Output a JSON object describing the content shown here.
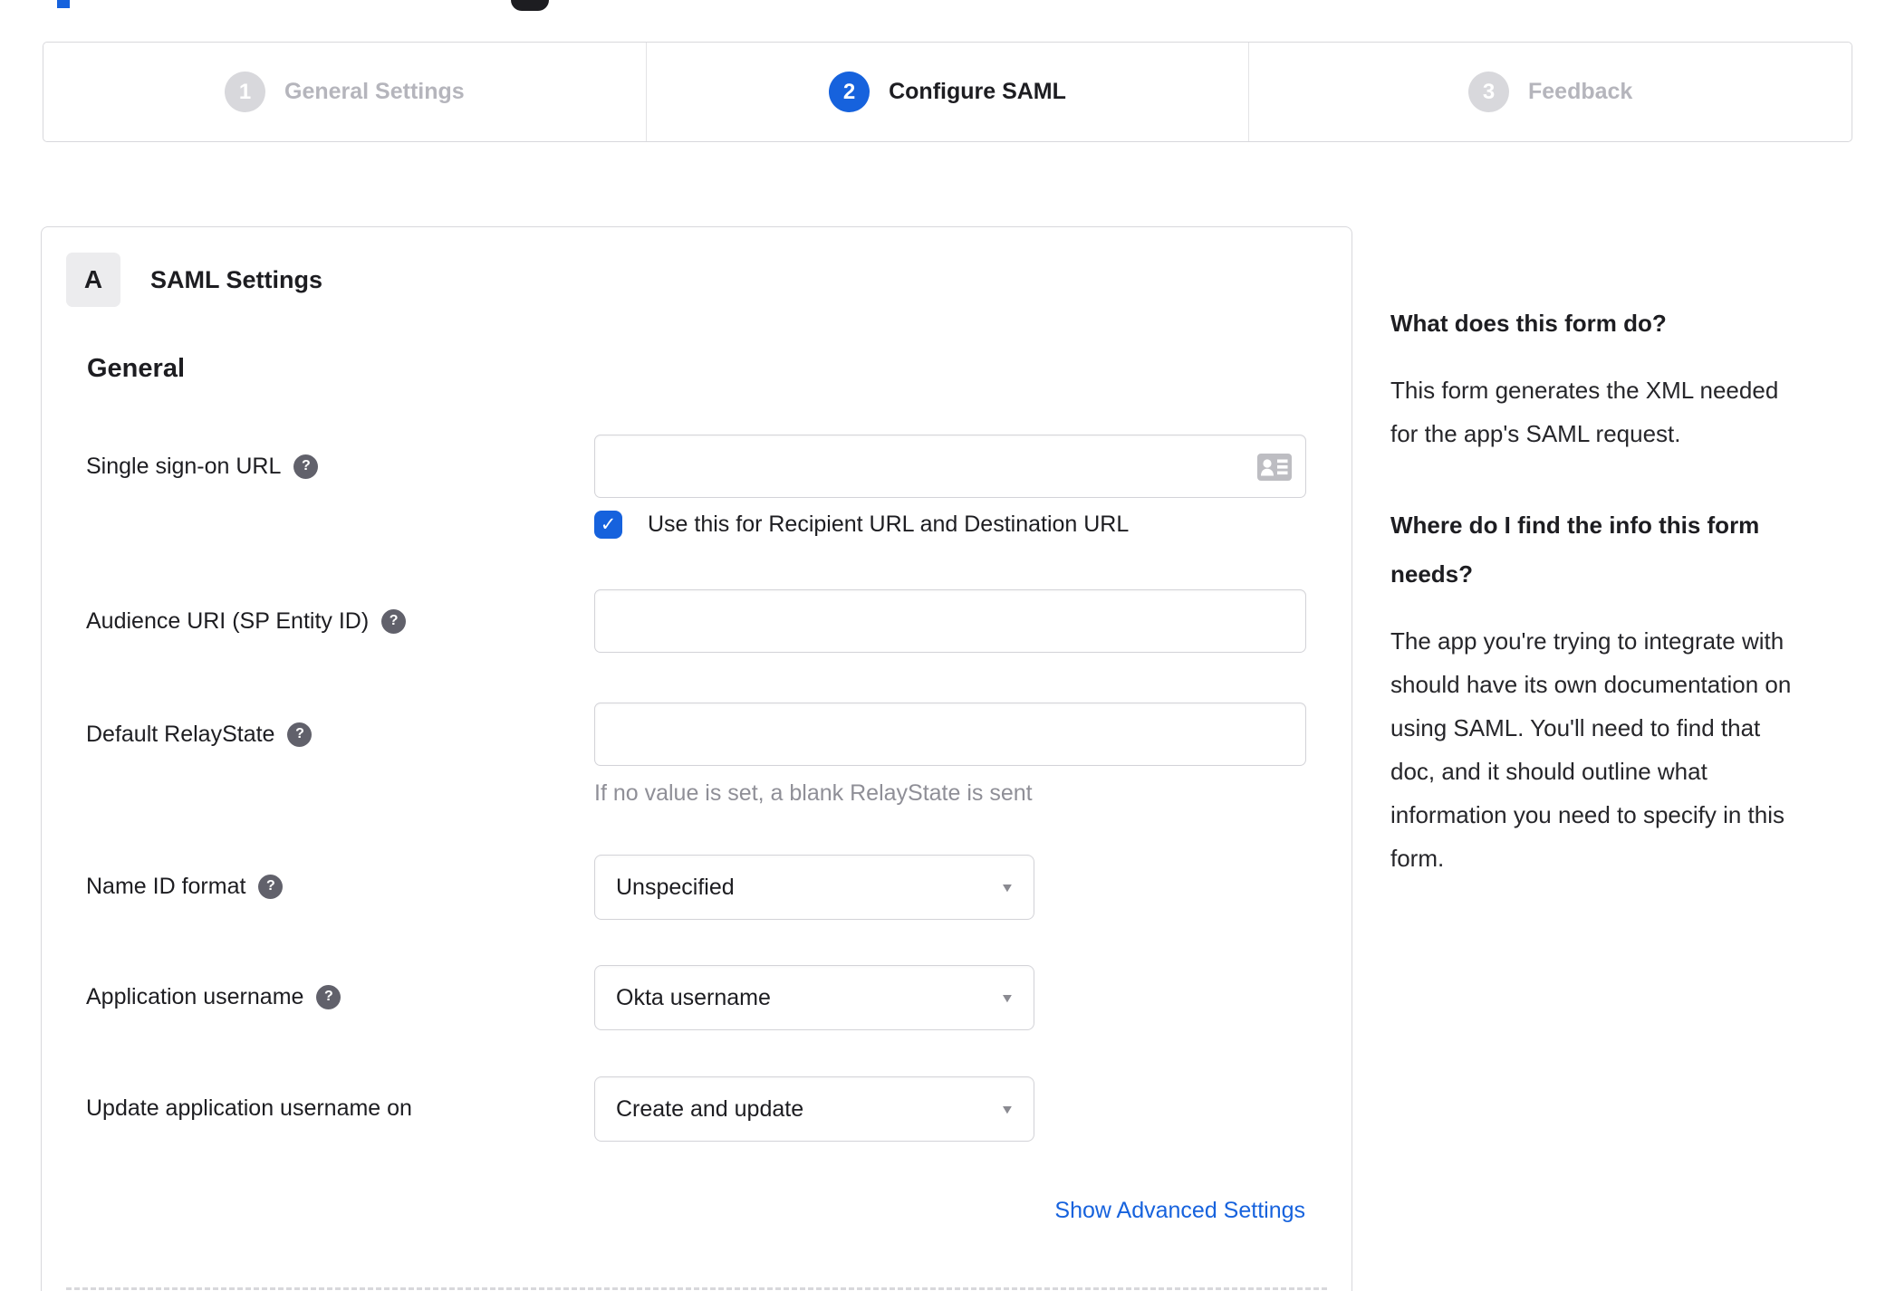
{
  "stepper": {
    "steps": [
      {
        "number": "1",
        "label": "General Settings",
        "active": false
      },
      {
        "number": "2",
        "label": "Configure SAML",
        "active": true
      },
      {
        "number": "3",
        "label": "Feedback",
        "active": false
      }
    ]
  },
  "panel": {
    "section_badge": "A",
    "section_title": "SAML Settings",
    "subsection_title": "General",
    "fields": [
      {
        "label": "Single sign-on URL",
        "type": "text",
        "value": "",
        "has_help": true,
        "trailing_icon": "contact-card-icon",
        "checkbox_checked": true,
        "checkbox_label": "Use this for Recipient URL and Destination URL"
      },
      {
        "label": "Audience URI (SP Entity ID)",
        "type": "text",
        "value": "",
        "has_help": true
      },
      {
        "label": "Default RelayState",
        "type": "text",
        "value": "",
        "has_help": true,
        "helper": "If no value is set, a blank RelayState is sent"
      },
      {
        "label": "Name ID format",
        "type": "select",
        "value": "Unspecified",
        "has_help": true
      },
      {
        "label": "Application username",
        "type": "select",
        "value": "Okta username",
        "has_help": true
      },
      {
        "label": "Update application username on",
        "type": "select",
        "value": "Create and update",
        "has_help": false
      }
    ],
    "advanced_link": "Show Advanced Settings"
  },
  "sidebar": {
    "blocks": [
      {
        "heading": "What does this form do?",
        "body": "This form generates the XML needed\nfor the app's SAML request."
      },
      {
        "heading": "Where do I find the info this form\nneeds?",
        "body": "The app you're trying to integrate with\nshould have its own documentation on\nusing SAML. You'll need to find that\ndoc, and it should outline what\ninformation you need to specify in this\nform."
      }
    ]
  },
  "icons": {
    "help_glyph": "?",
    "check_glyph": "✓",
    "caret_glyph": "▼"
  },
  "colors": {
    "accent_blue": "#1662dd",
    "border_gray": "#d8d8dc",
    "muted_text": "#8f8f97",
    "inactive_step": "#b5b5bc",
    "text": "#1d1d21"
  }
}
